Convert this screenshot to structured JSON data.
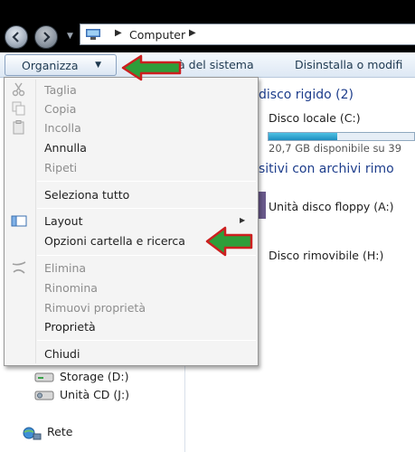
{
  "address_bar": {
    "crumb": "Computer"
  },
  "toolbar": {
    "organize_label": "Organizza",
    "system_props_label": "à del sistema",
    "uninstall_label": "Disinstalla o modifi"
  },
  "organize_menu": {
    "items": [
      {
        "label": "Taglia",
        "icon": "scissors-icon",
        "enabled": false
      },
      {
        "label": "Copia",
        "icon": "copy-icon",
        "enabled": false
      },
      {
        "label": "Incolla",
        "icon": "paste-icon",
        "enabled": false
      },
      {
        "label": "Annulla",
        "icon": "",
        "enabled": true
      },
      {
        "label": "Ripeti",
        "icon": "",
        "enabled": false
      },
      {
        "label": "Seleziona tutto",
        "icon": "",
        "enabled": true
      },
      {
        "label": "Layout",
        "icon": "layout-icon",
        "enabled": true,
        "submenu": true
      },
      {
        "label": "Opzioni cartella e ricerca",
        "icon": "",
        "enabled": true
      },
      {
        "label": "Elimina",
        "icon": "delete-x-icon",
        "enabled": false
      },
      {
        "label": "Rinomina",
        "icon": "",
        "enabled": false
      },
      {
        "label": "Rimuovi proprietà",
        "icon": "",
        "enabled": false
      },
      {
        "label": "Proprietà",
        "icon": "",
        "enabled": true
      },
      {
        "label": "Chiudi",
        "icon": "",
        "enabled": true
      }
    ]
  },
  "content": {
    "hard_disks_header": "disco rigido (2)",
    "local_disk_name": "Disco locale (C:)",
    "local_disk_free": "20,7 GB disponibile su 39",
    "local_disk_usage_fraction": 0.47,
    "removable_header": "sitivi con archivi rimo",
    "floppy_name": "Unità disco floppy (A:)",
    "removable_name": "Disco rimovibile (H:)"
  },
  "nav_tree": {
    "items": [
      {
        "label": "Storage (D:)",
        "icon": "drive-icon"
      },
      {
        "label": "Unità CD (J:)",
        "icon": "cd-drive-icon"
      },
      {
        "label": "Rete",
        "icon": "network-icon"
      }
    ]
  },
  "colors": {
    "annotation_arrow_fill": "#2e9e3a",
    "annotation_arrow_border": "#cc1f1f",
    "section_header": "#1e3e8c",
    "usage_bar": "#1f8fc0"
  }
}
